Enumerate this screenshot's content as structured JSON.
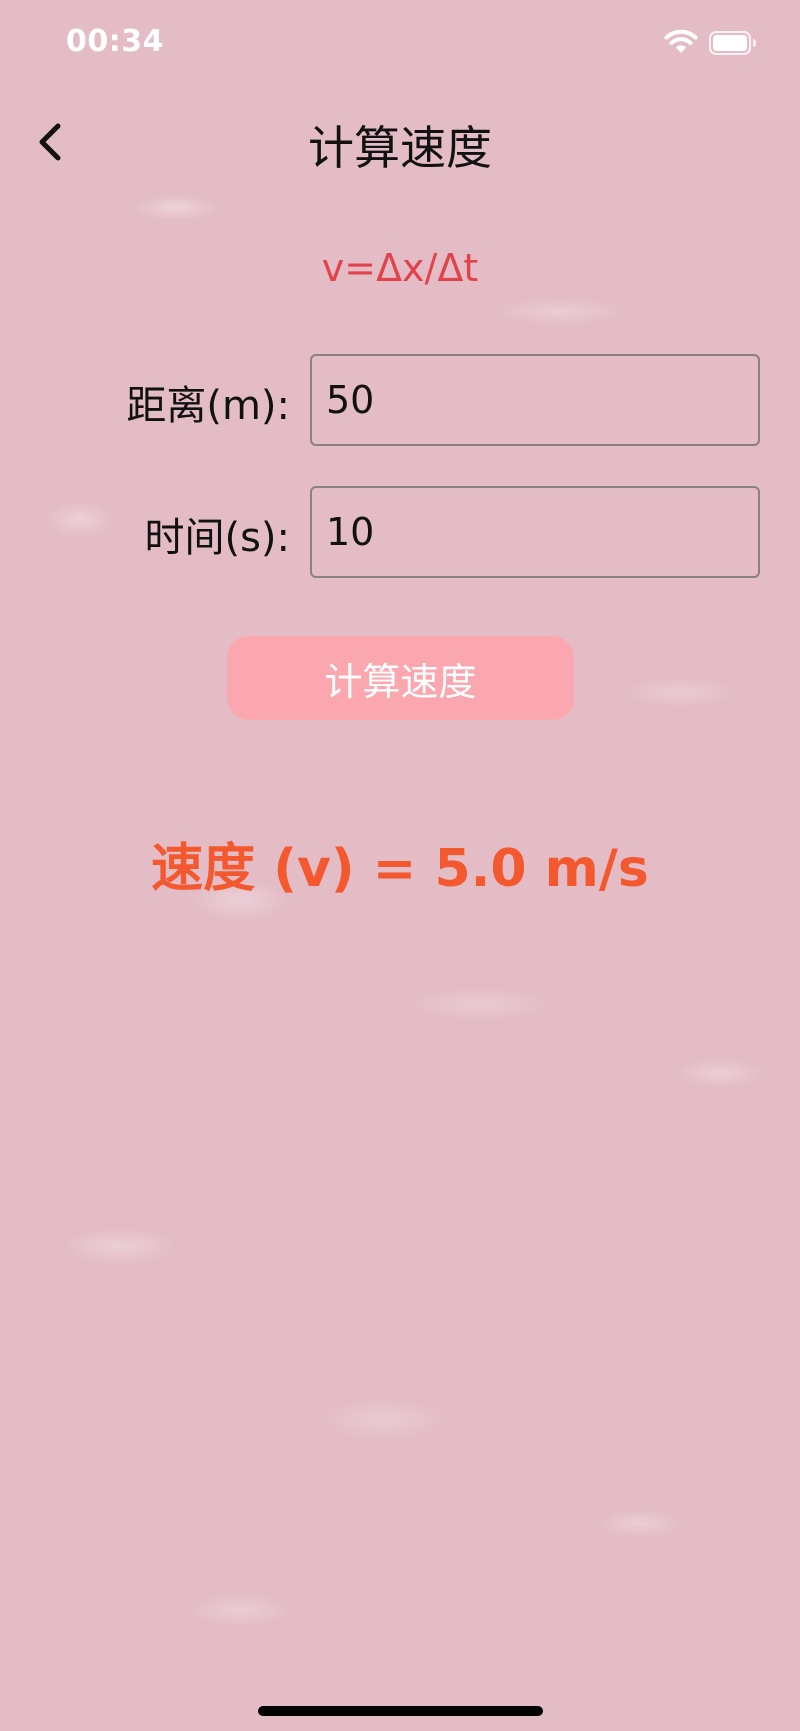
{
  "status_bar": {
    "time": "00:34"
  },
  "nav": {
    "title": "计算速度"
  },
  "formula": "v=Δx/Δt",
  "distance": {
    "label": "距离(m):",
    "value": "50"
  },
  "time": {
    "label": "时间(s):",
    "value": "10"
  },
  "button": {
    "label": "计算速度"
  },
  "result": "速度 (v) = 5.0 m/s",
  "colors": {
    "background": "#e4bcc6",
    "formula": "#e2434a",
    "button": "#fba7b0",
    "result": "#f4582e"
  }
}
